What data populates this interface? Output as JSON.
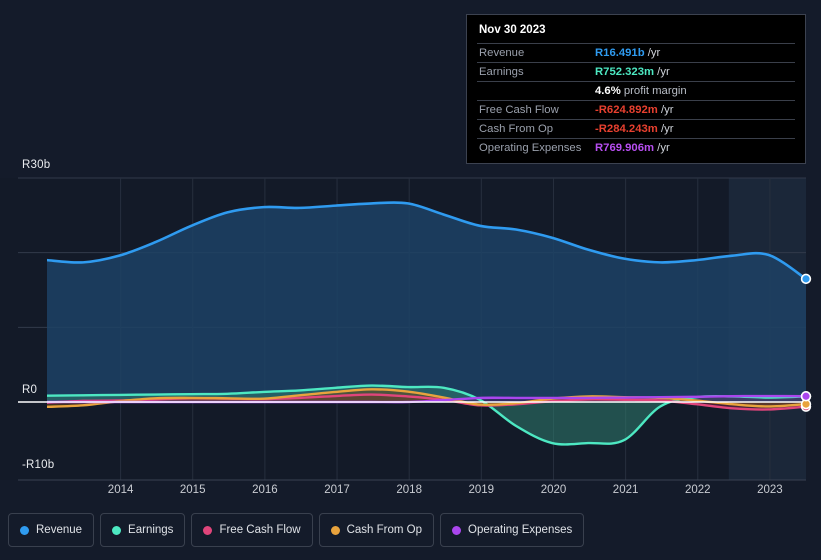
{
  "tooltip": {
    "date": "Nov 30 2023",
    "rows": [
      {
        "label": "Revenue",
        "value": "R16.491b",
        "unit": "/yr",
        "color": "#2f9bf0"
      },
      {
        "label": "Earnings",
        "value": "R752.323m",
        "unit": "/yr",
        "color": "#4de8c2"
      },
      {
        "label": "Free Cash Flow",
        "value": "-R624.892m",
        "unit": "/yr",
        "color": "#e8402f"
      },
      {
        "label": "Cash From Op",
        "value": "-R284.243m",
        "unit": "/yr",
        "color": "#e8402f"
      },
      {
        "label": "Operating Expenses",
        "value": "R769.906m",
        "unit": "/yr",
        "color": "#b74ef0"
      }
    ],
    "margin_value": "4.6%",
    "margin_label": "profit margin"
  },
  "legend": {
    "items": [
      {
        "label": "Revenue",
        "color": "#2f9bf0"
      },
      {
        "label": "Earnings",
        "color": "#4de8c2"
      },
      {
        "label": "Free Cash Flow",
        "color": "#e0457b"
      },
      {
        "label": "Cash From Op",
        "color": "#e8a33d"
      },
      {
        "label": "Operating Expenses",
        "color": "#aa46ee"
      }
    ]
  },
  "axes": {
    "y_ticks": [
      {
        "label": "R30b",
        "value": 30
      },
      {
        "label": "R0",
        "value": 0
      },
      {
        "label": "-R10b",
        "value": -10
      }
    ],
    "x_ticks": [
      "2014",
      "2015",
      "2016",
      "2017",
      "2018",
      "2019",
      "2020",
      "2021",
      "2022",
      "2023"
    ]
  },
  "chart_data": {
    "type": "area",
    "title": "",
    "xlabel": "",
    "ylabel": "ZAR",
    "ylim": [
      -10,
      30
    ],
    "xlim": [
      2013.3,
      2023.95
    ],
    "grid": true,
    "legend_position": "bottom",
    "currency": "ZAR",
    "unit": "billions",
    "x": [
      2013.4,
      2013.9,
      2014.4,
      2014.9,
      2015.4,
      2015.9,
      2016.4,
      2016.9,
      2017.4,
      2017.9,
      2018.4,
      2018.9,
      2019.4,
      2019.9,
      2020.4,
      2020.9,
      2021.4,
      2021.9,
      2022.4,
      2022.9,
      2023.4,
      2023.92
    ],
    "series": [
      {
        "name": "Revenue",
        "color": "#2f9bf0",
        "fill": "#1d4265",
        "values": [
          19.0,
          18.7,
          19.6,
          21.4,
          23.6,
          25.4,
          26.1,
          26.0,
          26.3,
          26.6,
          26.6,
          25.1,
          23.6,
          23.1,
          22.0,
          20.4,
          19.2,
          18.7,
          19.0,
          19.6,
          19.7,
          16.491
        ]
      },
      {
        "name": "Earnings",
        "color": "#4de8c2",
        "fill": "#2f7d6e",
        "values": [
          0.85,
          0.9,
          0.95,
          1.0,
          1.05,
          1.1,
          1.35,
          1.55,
          1.9,
          2.2,
          2.0,
          1.9,
          0.3,
          -3.2,
          -5.5,
          -5.5,
          -5.1,
          -0.6,
          0.65,
          0.75,
          0.6,
          0.752
        ]
      },
      {
        "name": "Free Cash Flow",
        "color": "#e0457b",
        "fill": "#6e2540",
        "values": [
          -0.1,
          0.15,
          0.2,
          0.35,
          0.5,
          0.45,
          0.4,
          0.55,
          0.8,
          1.0,
          0.75,
          0.3,
          -0.45,
          -0.3,
          0.1,
          0.35,
          0.3,
          0.2,
          -0.3,
          -0.85,
          -1.0,
          -0.625
        ]
      },
      {
        "name": "Cash From Op",
        "color": "#e8a33d",
        "fill": "#6b4a1d",
        "values": [
          -0.65,
          -0.45,
          0.1,
          0.5,
          0.55,
          0.5,
          0.45,
          0.9,
          1.35,
          1.7,
          1.4,
          0.6,
          -0.35,
          -0.15,
          0.45,
          0.75,
          0.65,
          0.55,
          0.2,
          -0.3,
          -0.6,
          -0.284
        ]
      },
      {
        "name": "Operating Expenses",
        "color": "#aa46ee",
        "fill": "#4b2168",
        "values": [
          0.0,
          0.0,
          0.0,
          0.0,
          0.0,
          0.0,
          0.0,
          0.0,
          0.0,
          0.0,
          0.0,
          0.25,
          0.55,
          0.55,
          0.55,
          0.55,
          0.6,
          0.65,
          0.7,
          0.78,
          0.8,
          0.77
        ]
      }
    ],
    "highlight_band": {
      "from": 2022.85,
      "to": 2023.95
    },
    "endpoint_markers": true
  }
}
